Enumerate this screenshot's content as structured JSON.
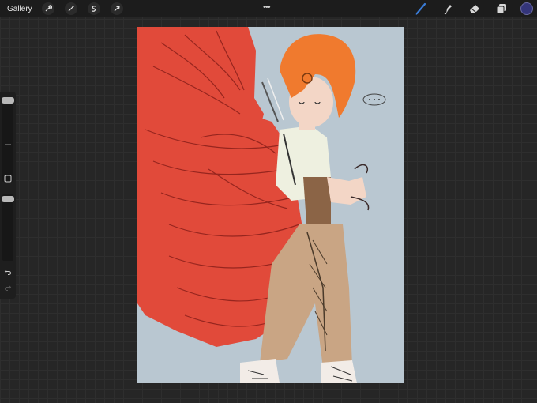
{
  "topbar": {
    "gallery_label": "Gallery",
    "left_tools": [
      "wrench-icon",
      "magic-wand-icon",
      "selection-icon",
      "transform-arrow-icon"
    ],
    "center_handle": "•••",
    "right_tools": [
      "brush-icon",
      "smudge-icon",
      "eraser-icon",
      "layers-icon"
    ],
    "active_color": "#34357a",
    "active_tool_color": "#3a7bd5"
  },
  "sidebar": {
    "tools": [
      "brush-size-slider",
      "modify-square-button",
      "opacity-slider",
      "undo-icon",
      "redo-icon"
    ]
  },
  "canvas": {
    "background_color": "#b9c7d1",
    "artwork": "drawing"
  }
}
